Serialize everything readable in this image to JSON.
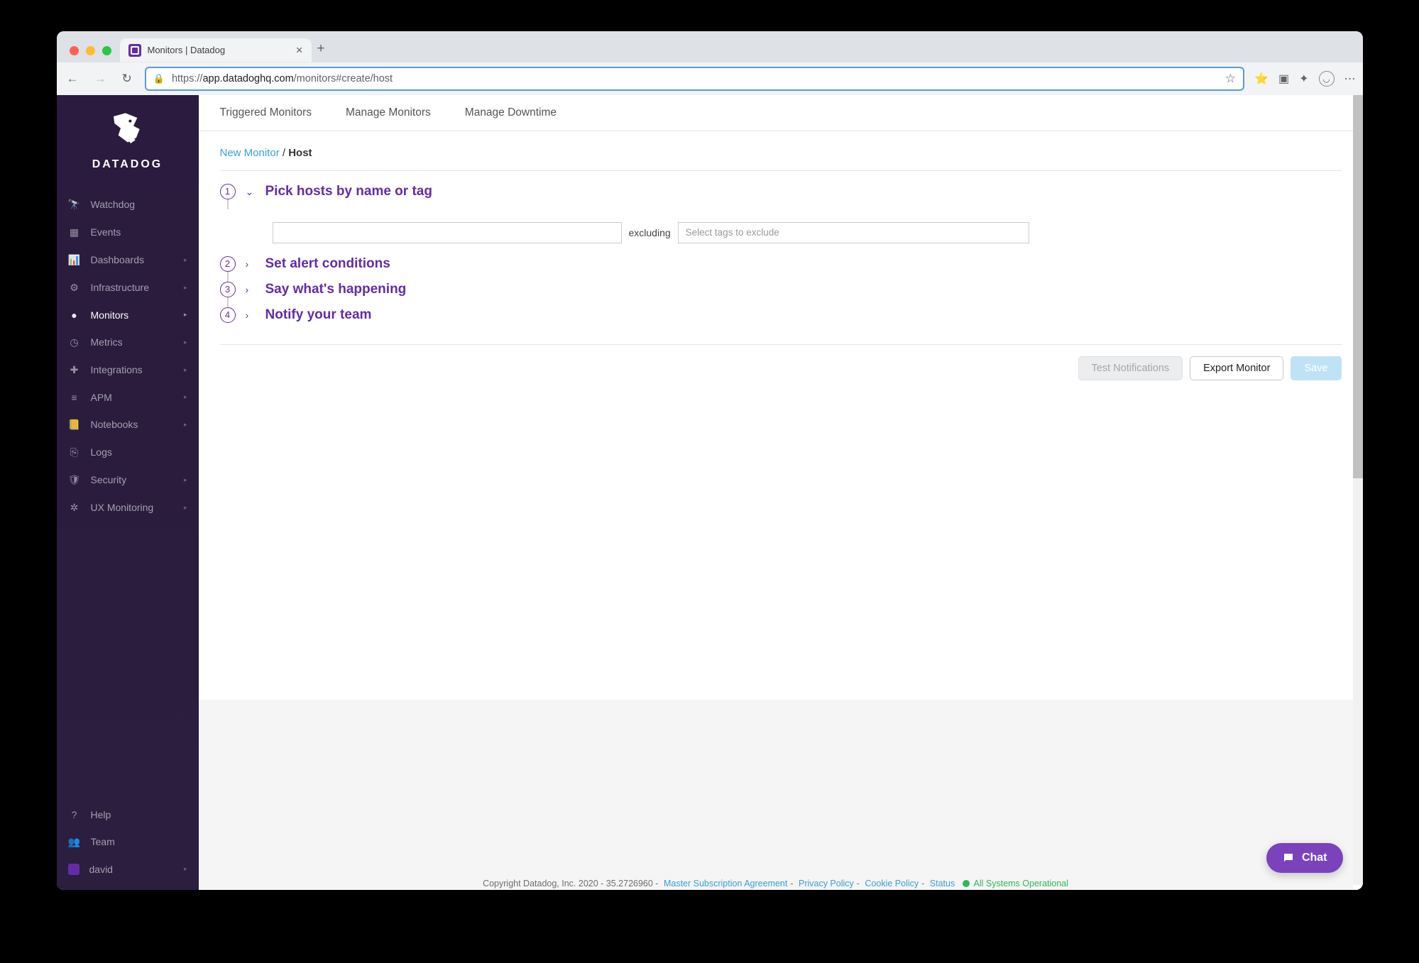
{
  "browser": {
    "tab_title": "Monitors | Datadog",
    "url_scheme": "https://",
    "url_host": "app.datadoghq.com",
    "url_path": "/monitors#create/host"
  },
  "brand": {
    "name": "DATADOG"
  },
  "sidebar": {
    "items": [
      {
        "label": "Watchdog",
        "icon": "binoculars"
      },
      {
        "label": "Events",
        "icon": "calendar"
      },
      {
        "label": "Dashboards",
        "icon": "chart",
        "expandable": true
      },
      {
        "label": "Infrastructure",
        "icon": "network",
        "expandable": true
      },
      {
        "label": "Monitors",
        "icon": "alert",
        "expandable": true,
        "active": true
      },
      {
        "label": "Metrics",
        "icon": "gauge",
        "expandable": true
      },
      {
        "label": "Integrations",
        "icon": "puzzle",
        "expandable": true
      },
      {
        "label": "APM",
        "icon": "trace",
        "expandable": true
      },
      {
        "label": "Notebooks",
        "icon": "book",
        "expandable": true
      },
      {
        "label": "Logs",
        "icon": "logs"
      },
      {
        "label": "Security",
        "icon": "shield",
        "expandable": true
      },
      {
        "label": "UX Monitoring",
        "icon": "ux",
        "expandable": true
      }
    ],
    "bottom": [
      {
        "label": "Help",
        "icon": "help"
      },
      {
        "label": "Team",
        "icon": "team"
      },
      {
        "label": "david",
        "icon": "avatar",
        "expandable": true
      }
    ]
  },
  "topnav": {
    "items": [
      {
        "label": "Triggered Monitors"
      },
      {
        "label": "Manage Monitors"
      },
      {
        "label": "Manage Downtime"
      }
    ]
  },
  "breadcrumb": {
    "link": "New Monitor",
    "current": "Host",
    "sep": " / "
  },
  "steps": [
    {
      "num": "1",
      "title": "Pick hosts by name or tag",
      "expanded": true
    },
    {
      "num": "2",
      "title": "Set alert conditions",
      "expanded": false
    },
    {
      "num": "3",
      "title": "Say what's happening",
      "expanded": false
    },
    {
      "num": "4",
      "title": "Notify your team",
      "expanded": false
    }
  ],
  "form": {
    "excluding_label": "excluding",
    "exclude_placeholder": "Select tags to exclude"
  },
  "actions": {
    "test": "Test Notifications",
    "export": "Export Monitor",
    "save": "Save"
  },
  "footer": {
    "copyright": "Copyright Datadog, Inc. 2020 - 35.2726960 -",
    "links": [
      "Master Subscription Agreement",
      "Privacy Policy",
      "Cookie Policy",
      "Status"
    ],
    "status": "All Systems Operational"
  },
  "chat": {
    "label": "Chat"
  }
}
